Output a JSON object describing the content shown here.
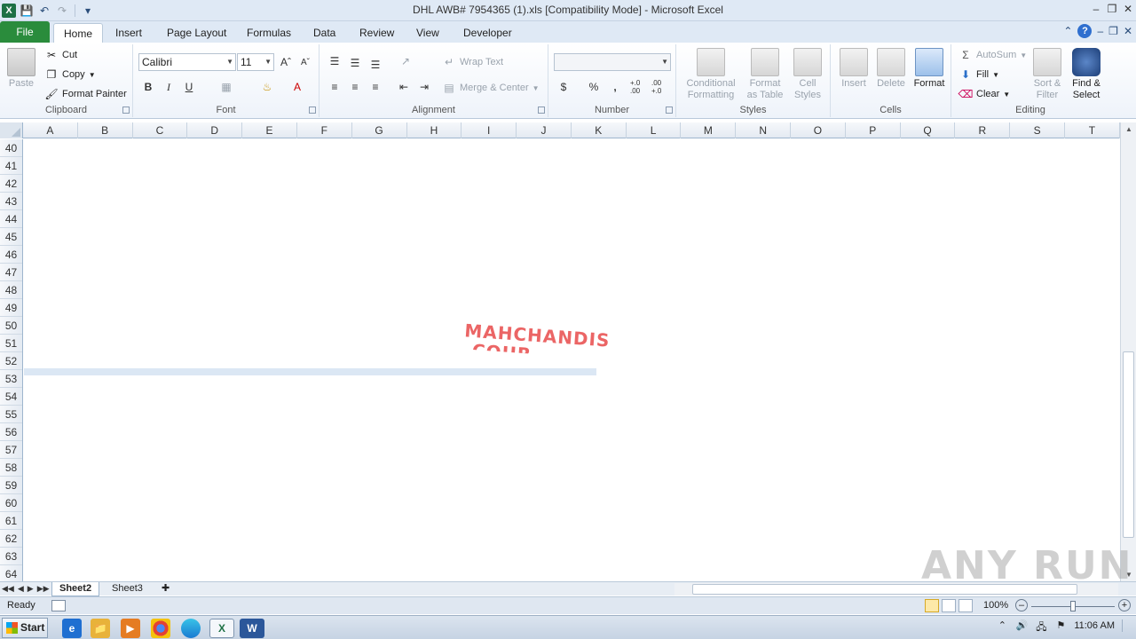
{
  "window": {
    "title": "DHL AWB# 7954365 (1).xls  [Compatibility Mode]  -  Microsoft Excel",
    "app_icon": "X"
  },
  "tabs": [
    "File",
    "Home",
    "Insert",
    "Page Layout",
    "Formulas",
    "Data",
    "Review",
    "View",
    "Developer"
  ],
  "active_tab": "Home",
  "ribbon": {
    "clipboard": {
      "label": "Clipboard",
      "paste": "Paste",
      "cut": "Cut",
      "copy": "Copy",
      "format_painter": "Format Painter"
    },
    "font": {
      "label": "Font",
      "name": "Calibri",
      "size": "11",
      "bold": "B",
      "italic": "I",
      "underline": "U"
    },
    "alignment": {
      "label": "Alignment",
      "wrap": "Wrap Text",
      "merge": "Merge & Center"
    },
    "number": {
      "label": "Number",
      "currency": "$",
      "percent": "%",
      "comma": ",",
      "inc_dec": "+.0 .00",
      "dec_dec": ".00 +.0"
    },
    "styles": {
      "label": "Styles",
      "conditional_1": "Conditional",
      "conditional_2": "Formatting",
      "table_1": "Format",
      "table_2": "as Table",
      "cell_1": "Cell",
      "cell_2": "Styles"
    },
    "cells": {
      "label": "Cells",
      "insert": "Insert",
      "delete": "Delete",
      "format": "Format"
    },
    "editing": {
      "label": "Editing",
      "autosum": "AutoSum",
      "fill": "Fill",
      "clear": "Clear",
      "sort_1": "Sort &",
      "sort_2": "Filter",
      "find_1": "Find &",
      "find_2": "Select"
    }
  },
  "columns": [
    "A",
    "B",
    "C",
    "D",
    "E",
    "F",
    "G",
    "H",
    "I",
    "J",
    "K",
    "L",
    "M",
    "N",
    "O",
    "P",
    "Q",
    "R",
    "S",
    "T"
  ],
  "rows": [
    "40",
    "41",
    "42",
    "43",
    "44",
    "45",
    "46",
    "47",
    "48",
    "49",
    "50",
    "51",
    "52",
    "53",
    "54",
    "55",
    "56",
    "57",
    "58",
    "59",
    "60",
    "61",
    "62",
    "63",
    "64"
  ],
  "stamp_text": {
    "line1": "MAHCHANDIS",
    "line2": "COUR"
  },
  "sheets": [
    "Sheet2",
    "Sheet3"
  ],
  "active_sheet": "Sheet2",
  "status": {
    "ready": "Ready",
    "zoom": "100%"
  },
  "taskbar": {
    "start": "Start",
    "time": "11:06 AM"
  },
  "watermark": "ANY RUN",
  "colors": {
    "file_tab": "#2a8c3c",
    "stamp": "#e84b4b",
    "selection": "#dbe7f4"
  }
}
